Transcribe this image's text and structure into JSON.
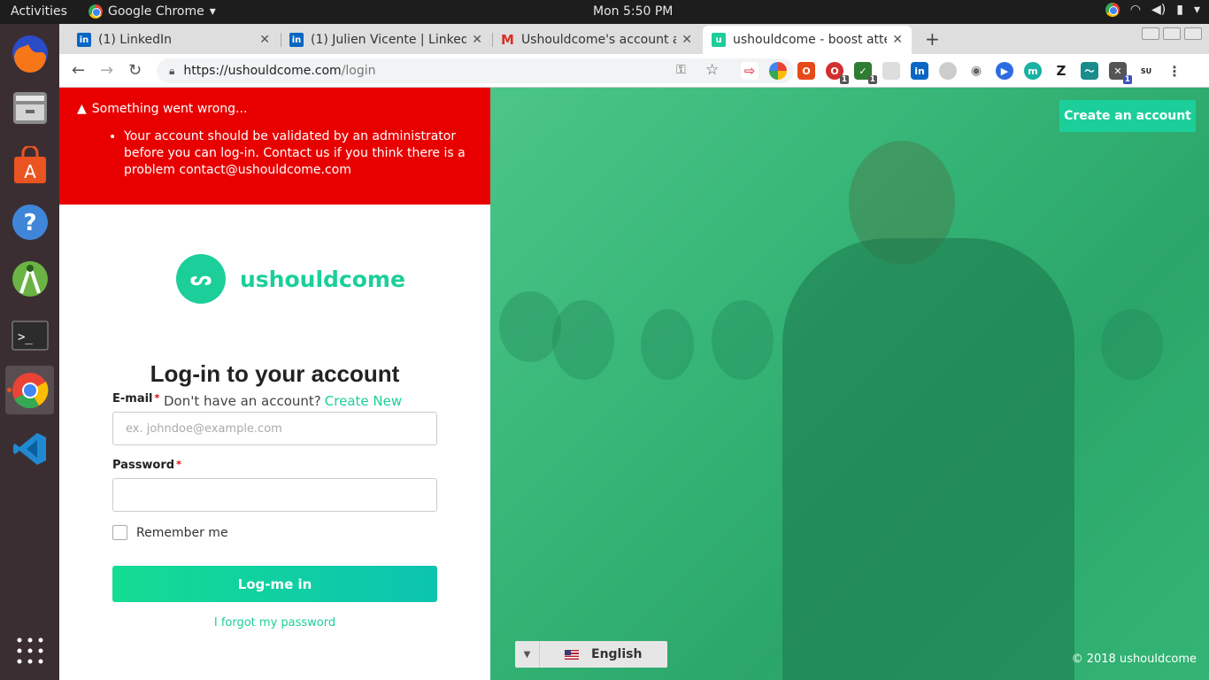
{
  "system": {
    "activities": "Activities",
    "app_name": "Google Chrome",
    "clock": "Mon  5:50 PM"
  },
  "tabs": [
    {
      "title": "(1) LinkedIn",
      "icon": "linkedin-icon"
    },
    {
      "title": "(1) Julien Vicente | Linked",
      "icon": "linkedin-icon"
    },
    {
      "title": "Ushouldcome's account a",
      "icon": "gmail-icon"
    },
    {
      "title": "ushouldcome - boost atte",
      "icon": "ushouldcome-icon",
      "active": true
    }
  ],
  "address_bar": {
    "url_host": "https://ushouldcome.com",
    "url_path": "/login"
  },
  "error": {
    "title": "Something went wrong...",
    "message": "Your account should be validated by an administrator before you can log-in. Contact us if you think there is a problem contact@ushouldcome.com"
  },
  "brand": {
    "name": "ushouldcome",
    "mark": "ᔕ"
  },
  "form": {
    "heading": "Log-in to your account",
    "email_label": "E-mail",
    "email_placeholder": "ex. johndoe@example.com",
    "signup_prompt": "Don't have an account?",
    "signup_link": "Create New",
    "password_label": "Password",
    "required_marker": "*",
    "remember_label": "Remember me",
    "submit_label": "Log-me in",
    "forgot_label": "I forgot my password"
  },
  "hero": {
    "create_account": "Create an account",
    "language": "English",
    "copyright": "© 2018 ushouldcome"
  },
  "colors": {
    "brand": "#1ccf9a",
    "error": "#e80000",
    "dock": "#3b2e33",
    "topbar": "#1d1d1d"
  }
}
